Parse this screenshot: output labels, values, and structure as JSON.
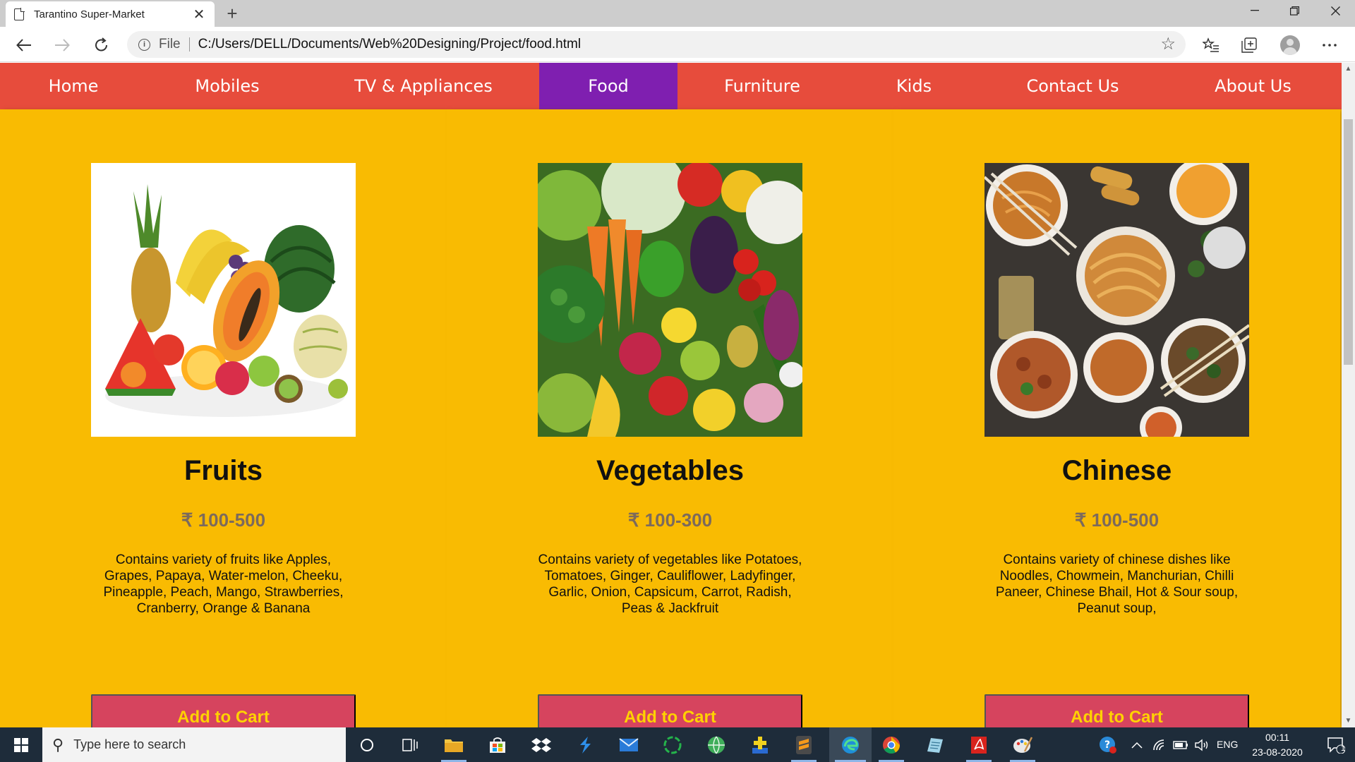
{
  "browser": {
    "tab_title": "Tarantino Super-Market",
    "tab_close": "✕",
    "new_tab": "+",
    "url_scheme": "File",
    "url": "C:/Users/DELL/Documents/Web%20Designing/Project/food.html"
  },
  "nav": {
    "items": [
      {
        "label": "Home"
      },
      {
        "label": "Mobiles"
      },
      {
        "label": "TV & Appliances"
      },
      {
        "label": "Food",
        "active": true
      },
      {
        "label": "Furniture"
      },
      {
        "label": "Kids"
      },
      {
        "label": "Contact Us"
      },
      {
        "label": "About Us"
      }
    ],
    "colors": {
      "bar": "#e74c3c",
      "active": "#7f1fb0",
      "text": "#ffffff"
    }
  },
  "page": {
    "background": "#f9bb02",
    "products": [
      {
        "title": "Fruits",
        "price": "₹ 100-500",
        "description": "Contains variety of fruits like Apples, Grapes, Papaya, Water-melon, Cheeku, Pineapple, Peach, Mango, Strawberries, Cranberry, Orange & Banana",
        "button": "Add to Cart",
        "image": "fruits-photo"
      },
      {
        "title": "Vegetables",
        "price": "₹ 100-300",
        "description": "Contains variety of vegetables like Potatoes, Tomatoes, Ginger, Cauliflower, Ladyfinger, Garlic, Onion, Capsicum, Carrot, Radish, Peas & Jackfruit",
        "button": "Add to Cart",
        "image": "vegetables-photo"
      },
      {
        "title": "Chinese",
        "price": "₹ 100-500",
        "description": "Contains variety of chinese dishes like Noodles, Chowmein, Manchurian, Chilli Paneer, Chinese Bhail, Hot & Sour soup, Peanut soup,",
        "button": "Add to Cart",
        "image": "chinese-food-photo"
      }
    ],
    "button_colors": {
      "background": "#d6445e",
      "text": "#ffd200"
    }
  },
  "taskbar": {
    "search_placeholder": "Type here to search",
    "language": "ENG",
    "time": "00:11",
    "date": "23-08-2020",
    "notification_count": "1"
  }
}
